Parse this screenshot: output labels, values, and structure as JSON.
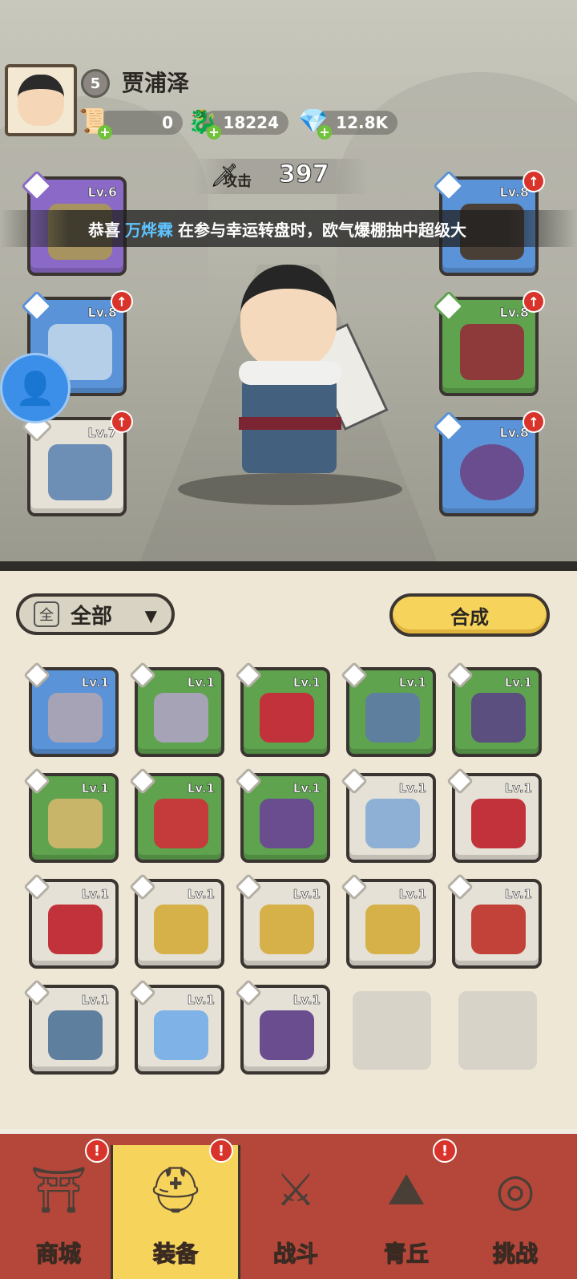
{
  "player": {
    "level": "5",
    "name": "贾浦泽"
  },
  "resources": [
    {
      "name": "scroll-icon",
      "value": "0"
    },
    {
      "name": "jade-dragon-icon",
      "value": "18224"
    },
    {
      "name": "crystal-icon",
      "value": "12.8K"
    }
  ],
  "attack": {
    "label": "攻击",
    "value": "397"
  },
  "marquee": {
    "prefix": "恭喜",
    "player": "万烨霖",
    "suffix": "在参与幸运转盘时，欧气爆棚抽中超级大"
  },
  "equipped": [
    {
      "slot": "weapon",
      "level": "Lv.6",
      "rarity": "purple",
      "icon": "ring-blade-icon",
      "upgrade": false
    },
    {
      "slot": "armor",
      "level": "Lv.8",
      "rarity": "blue",
      "icon": "frost-armor-icon",
      "upgrade": true
    },
    {
      "slot": "bracer",
      "level": "Lv.7",
      "rarity": "gray",
      "icon": "ice-bracer-icon",
      "upgrade": true
    },
    {
      "slot": "belt",
      "level": "Lv.8",
      "rarity": "blue",
      "icon": "belt-icon",
      "upgrade": true
    },
    {
      "slot": "boots",
      "level": "Lv.8",
      "rarity": "green",
      "icon": "red-boots-icon",
      "upgrade": true
    },
    {
      "slot": "amulet",
      "level": "Lv.8",
      "rarity": "blue",
      "icon": "amulet-icon",
      "upgrade": true
    }
  ],
  "filter": {
    "icon_text": "全",
    "label": "全部",
    "chevron": "▼"
  },
  "merge_label": "合成",
  "inventory": [
    {
      "level": "Lv.1",
      "rarity": "blue",
      "icon": "hammer-icon",
      "color": "#a5a3b5"
    },
    {
      "level": "Lv.1",
      "rarity": "green",
      "icon": "hammer-icon",
      "color": "#a5a3b5"
    },
    {
      "level": "Lv.1",
      "rarity": "green",
      "icon": "red-armor-icon",
      "color": "#c2323a"
    },
    {
      "level": "Lv.1",
      "rarity": "green",
      "icon": "frost-belt-icon",
      "color": "#5f7f9f"
    },
    {
      "level": "Lv.1",
      "rarity": "green",
      "icon": "purple-belt-icon",
      "color": "#5a4f7f"
    },
    {
      "level": "Lv.1",
      "rarity": "green",
      "icon": "gold-boots-icon",
      "color": "#c9b56a"
    },
    {
      "level": "Lv.1",
      "rarity": "green",
      "icon": "red-orb-icon",
      "color": "#c53a3a"
    },
    {
      "level": "Lv.1",
      "rarity": "green",
      "icon": "amulet-icon",
      "color": "#6a4d8f"
    },
    {
      "level": "Lv.1",
      "rarity": "gray",
      "icon": "bow-icon",
      "color": "#8fb0d5"
    },
    {
      "level": "Lv.1",
      "rarity": "gray",
      "icon": "red-armor-icon",
      "color": "#c2323a"
    },
    {
      "level": "Lv.1",
      "rarity": "gray",
      "icon": "red-armor-icon",
      "color": "#c2323a"
    },
    {
      "level": "Lv.1",
      "rarity": "gray",
      "icon": "gold-armor-icon",
      "color": "#d6b14a"
    },
    {
      "level": "Lv.1",
      "rarity": "gray",
      "icon": "gold-armor-icon",
      "color": "#d6b14a"
    },
    {
      "level": "Lv.1",
      "rarity": "gray",
      "icon": "gold-armor-icon",
      "color": "#d6b14a"
    },
    {
      "level": "Lv.1",
      "rarity": "gray",
      "icon": "red-belt-icon",
      "color": "#c2423a"
    },
    {
      "level": "Lv.1",
      "rarity": "gray",
      "icon": "frost-belt-icon",
      "color": "#5f7f9f"
    },
    {
      "level": "Lv.1",
      "rarity": "gray",
      "icon": "crystal-pendant-icon",
      "color": "#7fb2e6"
    },
    {
      "level": "Lv.1",
      "rarity": "gray",
      "icon": "amulet-icon",
      "color": "#6a4d8f"
    }
  ],
  "nav": [
    {
      "label": "商城",
      "icon": "shop-icon",
      "glyph": "⛩",
      "alert": true,
      "active": false
    },
    {
      "label": "装备",
      "icon": "equipment-icon",
      "glyph": "⛑",
      "alert": true,
      "active": true
    },
    {
      "label": "战斗",
      "icon": "battle-icon",
      "glyph": "⚔",
      "alert": false,
      "active": false
    },
    {
      "label": "青丘",
      "icon": "mountain-icon",
      "glyph": "⛰",
      "alert": true,
      "active": false
    },
    {
      "label": "挑战",
      "icon": "challenge-icon",
      "glyph": "◎",
      "alert": false,
      "active": false
    }
  ]
}
